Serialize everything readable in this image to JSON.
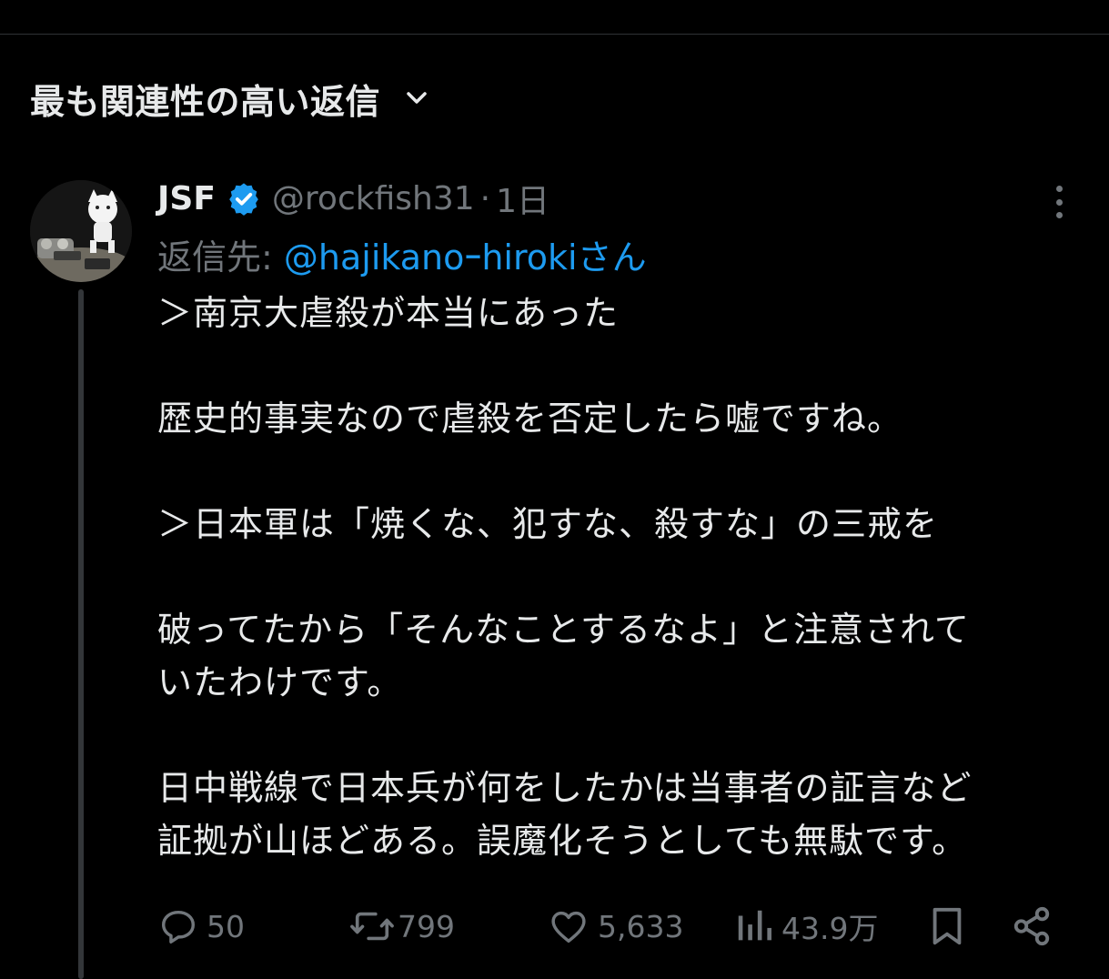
{
  "section": {
    "sort_label": "最も関連性の高い返信"
  },
  "tweet": {
    "display_name": "JSF",
    "handle": "@rockfish31",
    "separator": "·",
    "time": "1日",
    "reply_prefix": "返信先: ",
    "reply_mention": "@hajikanoｰhirokiさん",
    "lines": [
      "＞南京大虐殺が本当にあった",
      "",
      "歴史的事実なので虐殺を否定したら嘘ですね。",
      "",
      "＞日本軍は「焼くな、犯すな、殺すな」の三戒を",
      "",
      "破ってたから「そんなことするなよ」と注意されて",
      "いたわけです。",
      "",
      "日中戦線で日本兵が何をしたかは当事者の証言など",
      "証拠が山ほどある。誤魔化そうとしても無駄です。"
    ],
    "stats": {
      "replies": "50",
      "retweets": "799",
      "likes": "5,633",
      "views": "43.9万"
    }
  },
  "colors": {
    "background": "#000000",
    "text": "#e7e9ea",
    "muted": "#71767b",
    "accent": "#1d9bf0",
    "divider": "#2f3336"
  },
  "icons": {
    "sort": "chevron-down-icon",
    "verified": "verified-badge-icon",
    "more": "more-dots-icon",
    "reply": "reply-icon",
    "retweet": "retweet-icon",
    "like": "heart-icon",
    "views": "views-chart-icon",
    "bookmark": "bookmark-icon",
    "share": "share-icon"
  }
}
